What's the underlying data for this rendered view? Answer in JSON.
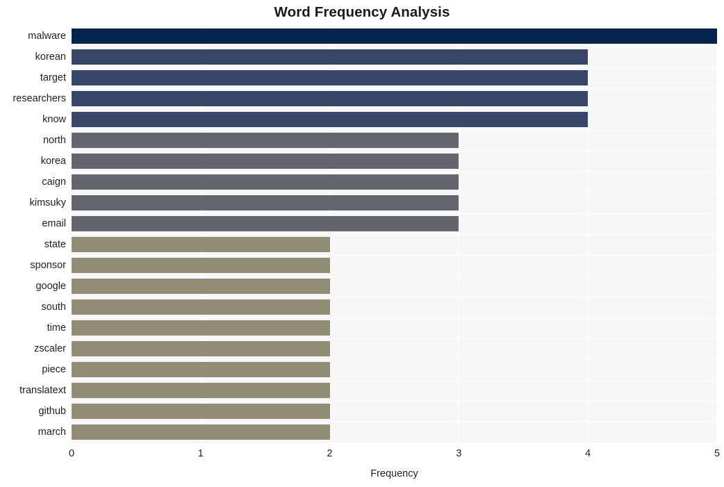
{
  "chart_data": {
    "type": "bar",
    "orientation": "horizontal",
    "title": "Word Frequency Analysis",
    "xlabel": "Frequency",
    "ylabel": "",
    "xlim": [
      0,
      5
    ],
    "xticks": [
      0,
      1,
      2,
      3,
      4,
      5
    ],
    "xticklabels": [
      "0",
      "1",
      "2",
      "3",
      "4",
      "5"
    ],
    "grid": true,
    "legend": null,
    "categories": [
      "malware",
      "korean",
      "target",
      "researchers",
      "know",
      "north",
      "korea",
      "caign",
      "kimsuky",
      "email",
      "state",
      "sponsor",
      "google",
      "south",
      "time",
      "zscaler",
      "piece",
      "translatext",
      "github",
      "march"
    ],
    "values": [
      5,
      4,
      4,
      4,
      4,
      3,
      3,
      3,
      3,
      3,
      2,
      2,
      2,
      2,
      2,
      2,
      2,
      2,
      2,
      2
    ],
    "bar_colors": [
      "#04244c",
      "#374668",
      "#374668",
      "#374668",
      "#374668",
      "#64666f",
      "#64666f",
      "#64666f",
      "#64666f",
      "#64666f",
      "#928d76",
      "#928d76",
      "#928d76",
      "#928d76",
      "#928d76",
      "#928d76",
      "#928d76",
      "#928d76",
      "#928d76",
      "#928d76"
    ],
    "plot_background": "#f7f7f7",
    "gridline_color": "#ffffff",
    "figure_background": "#ffffff"
  }
}
